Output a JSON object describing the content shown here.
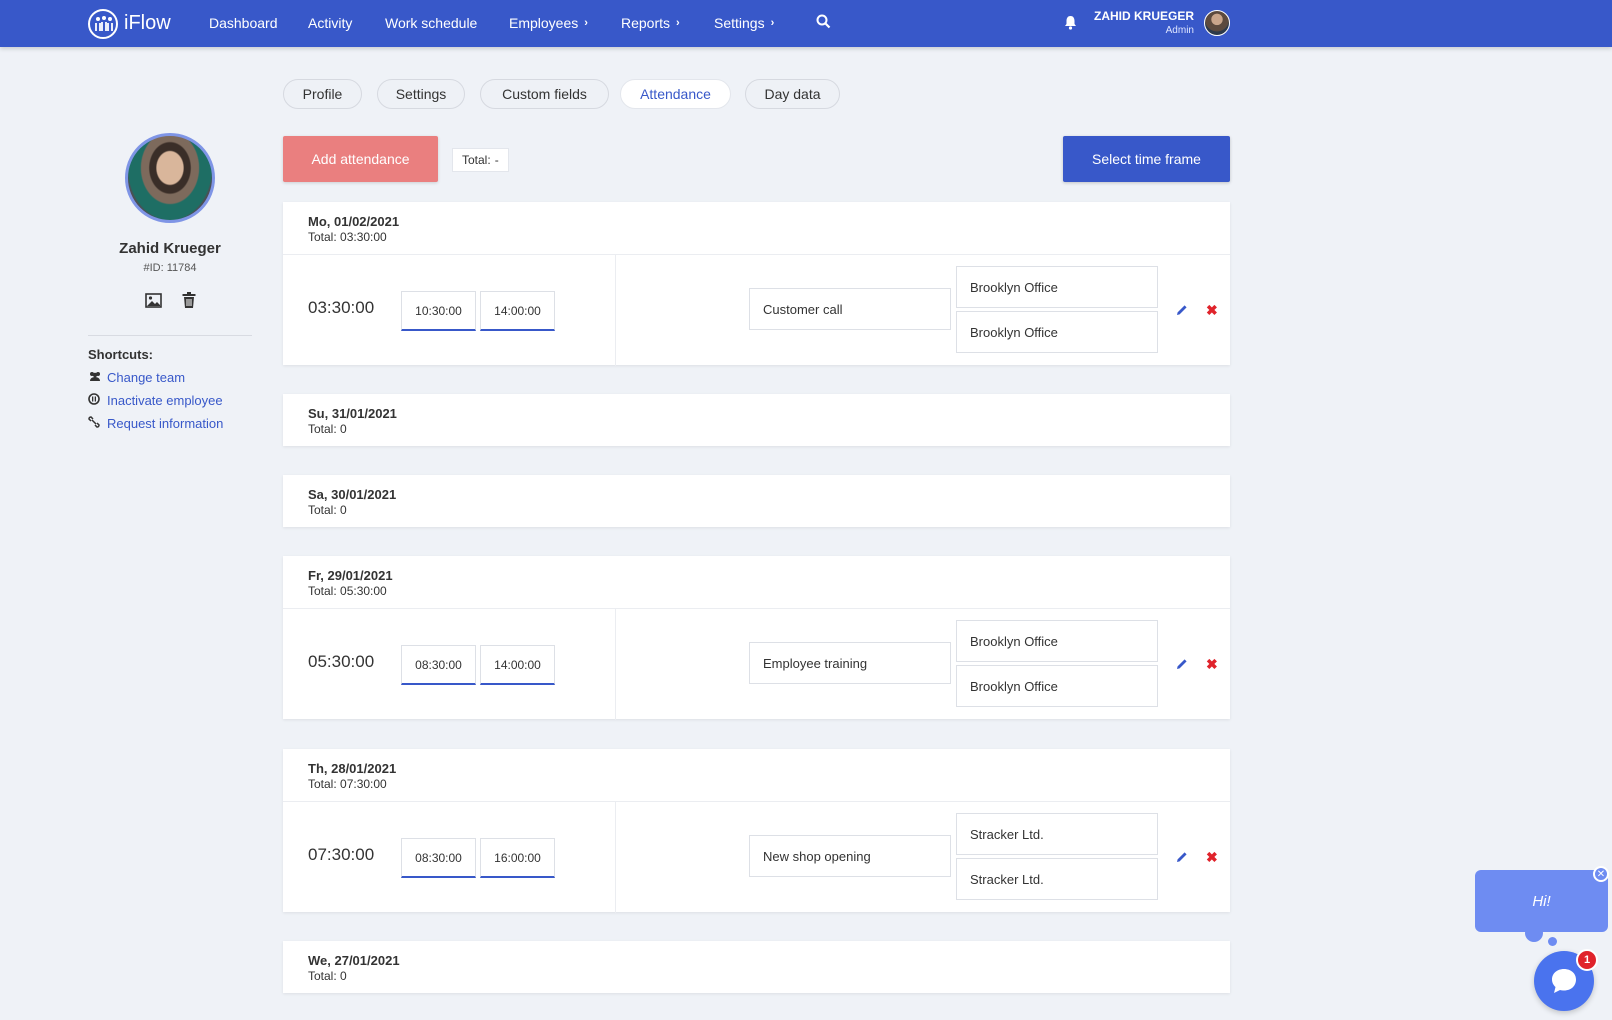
{
  "app": {
    "name": "iFlow"
  },
  "nav": {
    "dashboard": "Dashboard",
    "activity": "Activity",
    "work_schedule": "Work schedule",
    "employees": "Employees",
    "reports": "Reports",
    "settings": "Settings"
  },
  "user": {
    "name": "ZAHID KRUEGER",
    "role": "Admin"
  },
  "tabs": {
    "profile": "Profile",
    "settings": "Settings",
    "custom_fields": "Custom fields",
    "attendance": "Attendance",
    "day_data": "Day data"
  },
  "profile": {
    "name": "Zahid Krueger",
    "id": "#ID: 11784"
  },
  "shortcuts": {
    "title": "Shortcuts:",
    "change_team": "Change team",
    "inactivate": "Inactivate employee",
    "request": "Request information"
  },
  "actions": {
    "add": "Add attendance",
    "total_label": "Total:",
    "total_value": "-",
    "select_timeframe": "Select time frame"
  },
  "days": {
    "d1": {
      "title": "Mo, 01/02/2021",
      "total": "Total: 03:30:00",
      "duration": "03:30:00",
      "start": "10:30:00",
      "end": "14:00:00",
      "description": "Customer call",
      "location_start": "Brooklyn Office",
      "location_end": "Brooklyn Office"
    },
    "d2": {
      "title": "Su, 31/01/2021",
      "total": "Total: 0"
    },
    "d3": {
      "title": "Sa, 30/01/2021",
      "total": "Total: 0"
    },
    "d4": {
      "title": "Fr, 29/01/2021",
      "total": "Total: 05:30:00",
      "duration": "05:30:00",
      "start": "08:30:00",
      "end": "14:00:00",
      "description": "Employee training",
      "location_start": "Brooklyn Office",
      "location_end": "Brooklyn Office"
    },
    "d5": {
      "title": "Th, 28/01/2021",
      "total": "Total: 07:30:00",
      "duration": "07:30:00",
      "start": "08:30:00",
      "end": "16:00:00",
      "description": "New shop opening",
      "location_start": "Stracker Ltd.",
      "location_end": "Stracker Ltd."
    },
    "d6": {
      "title": "We, 27/01/2021",
      "total": "Total: 0"
    }
  },
  "chat": {
    "greeting": "Hi!",
    "count": "1"
  },
  "colors": {
    "primary": "#3858c9",
    "add_button": "#ea7f7f",
    "delete": "#e0232b"
  },
  "icons": [
    "logo-icon",
    "search-icon",
    "bell-icon",
    "image-icon",
    "trash-icon",
    "users-icon",
    "pause-circle-icon",
    "link-icon",
    "pencil-icon",
    "close-icon",
    "chat-icon"
  ]
}
